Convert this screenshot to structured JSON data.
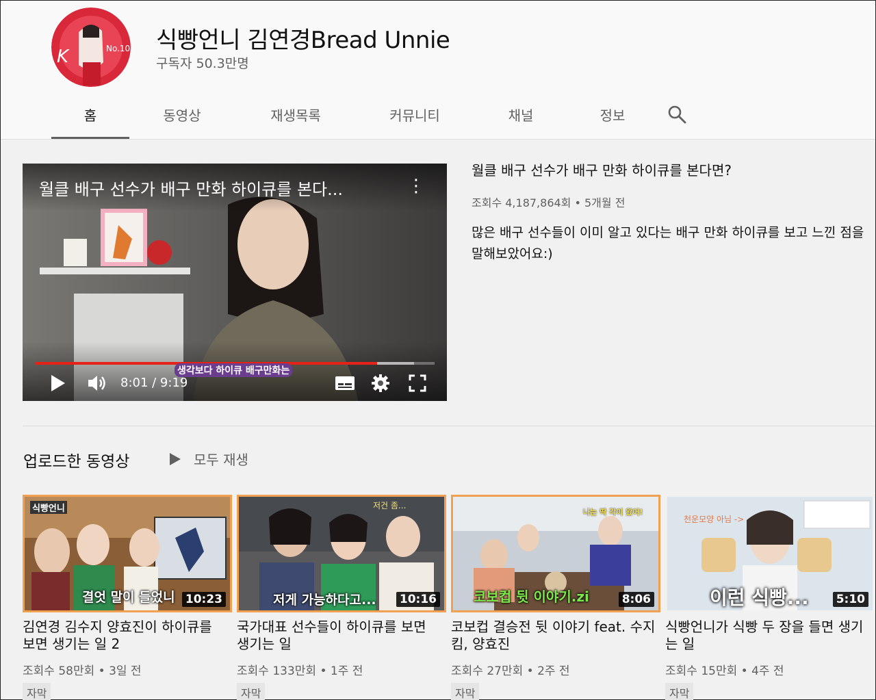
{
  "channel": {
    "name": "식빵언니 김연경Bread Unnie",
    "subscribers": "구독자 50.3만명"
  },
  "tabs": [
    {
      "label": "홈",
      "active": true
    },
    {
      "label": "동영상"
    },
    {
      "label": "재생목록"
    },
    {
      "label": "커뮤니티"
    },
    {
      "label": "채널"
    },
    {
      "label": "정보"
    }
  ],
  "featured": {
    "overlay_title": "월클 배구 선수가 배구 만화 하이큐를 본다...",
    "title": "월클 배구 선수가 배구 만화 하이큐를 본다면?",
    "meta": "조회수 4,187,864회 • 5개월 전",
    "description": "많은 배구 선수들이 이미 알고 있다는 배구 만화 하이큐를 보고 느낀 점을 말해보았어요:)",
    "time": "8:01 / 9:19",
    "caption": "생각보다 하이큐 배구만화는",
    "progress": 0.87,
    "buffered": 0.95
  },
  "shelf": {
    "title": "업로드한 동영상",
    "play_all": "모두 재생"
  },
  "videos": [
    {
      "title": "김연경 김수지 양효진이 하이큐를 보면 생기는 일 2",
      "meta": "조회수 58만회 • 3일 전",
      "badge": "자막",
      "duration": "10:23",
      "thumb_text": "결엇 말이 들었니",
      "thumb_top_text": "식빵언니"
    },
    {
      "title": "국가대표 선수들이 하이큐를 보면 생기는 일",
      "meta": "조회수 133만회 • 1주 전",
      "badge": "자막",
      "duration": "10:16",
      "thumb_text": "저게 가능하다고...",
      "thumb_top_text": "저건 좀..."
    },
    {
      "title": "코보컵 결승전 뒷 이야기 feat. 수지킴, 양효진",
      "meta": "조회수 27만회 • 2주 전",
      "badge": "자막",
      "duration": "8:06",
      "thumb_text": "코보컵 뒷 이야기.zi",
      "thumb_top_text": "나는 딱 각이 왔어!"
    },
    {
      "title": "식빵언니가 식빵 두 장을 들면 생기는 일",
      "meta": "조회수 15만회 • 4주 전",
      "badge": "자막",
      "duration": "5:10",
      "thumb_text": "이런 식빵...",
      "thumb_top_text": "천운모양 아님 ->"
    }
  ]
}
